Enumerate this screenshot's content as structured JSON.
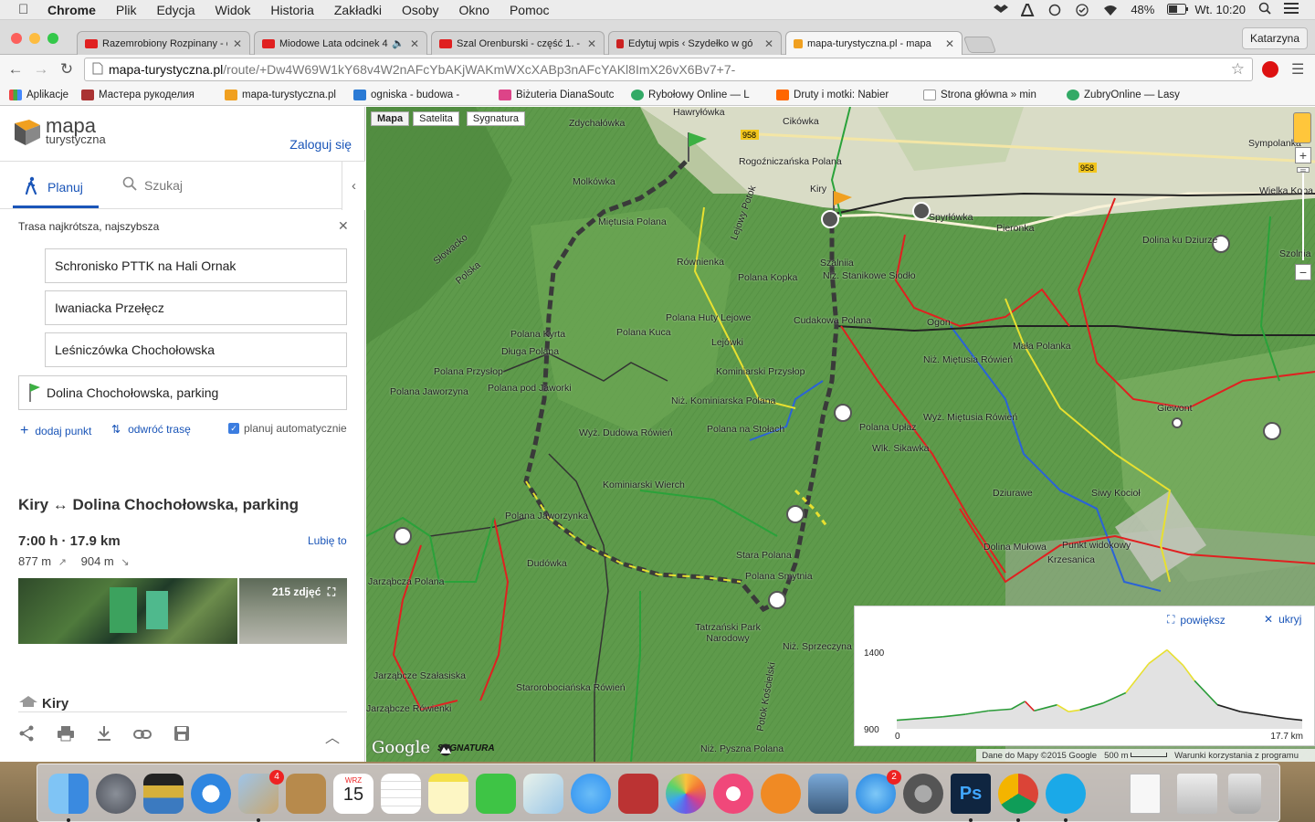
{
  "menubar": {
    "app": "Chrome",
    "items": [
      "Plik",
      "Edycja",
      "Widok",
      "Historia",
      "Zakładki",
      "Osoby",
      "Okno",
      "Pomoc"
    ],
    "battery": "48%",
    "clock": "Wt. 10:20"
  },
  "tabs": [
    {
      "title": "Razemrobiony Rozpinany - o",
      "favicon_color": "#e02020"
    },
    {
      "title": "Miodowe Lata odcinek 4",
      "favicon_color": "#e02020"
    },
    {
      "title": "Szal Orenburski - część 1. -",
      "favicon_color": "#e02020"
    },
    {
      "title": "Edytuj wpis ‹ Szydełko w gó",
      "favicon_color": "#c22"
    },
    {
      "title": "mapa-turystyczna.pl - mapa",
      "favicon_color": "#f0a020"
    }
  ],
  "profile": "Katarzyna",
  "url": {
    "domain": "mapa-turystyczna.pl",
    "path": "/route/+Dw4W69W1kY68v4W2nAFcYbAKjWAKmWXcXABp3nAFcYAKl8ImX26vX6Bv7+7-"
  },
  "bookmarks": [
    {
      "label": "Aplikacje",
      "color": "#e44"
    },
    {
      "label": "Мастера рукоделия",
      "color": "#a33"
    },
    {
      "label": "mapa-turystyczna.pl",
      "color": "#f0a020"
    },
    {
      "label": "ogniska - budowa -",
      "color": "#2a7ad5"
    },
    {
      "label": "Biżuteria DianaSoutc",
      "color": "#d48"
    },
    {
      "label": "Rybołowy Online — L",
      "color": "#3a6"
    },
    {
      "label": "Druty i motki: Nabier",
      "color": "#f60"
    },
    {
      "label": "Strona główna » min",
      "color": "#aaa"
    },
    {
      "label": "ŻubryOnline — Lasy",
      "color": "#3a6"
    }
  ],
  "sidebar": {
    "logo_line1": "mapa",
    "logo_line2": "turystyczna",
    "login": "Zaloguj się",
    "tab_plan": "Planuj",
    "tab_search": "Szukaj",
    "route_type": "Trasa najkrótsza, najszybsza",
    "waypoints": [
      "Schronisko PTTK na Hali Ornak",
      "Iwaniacka Przełęcz",
      "Leśniczówka Chochołowska"
    ],
    "destination": "Dolina Chochołowska, parking",
    "add_point": "dodaj punkt",
    "reverse": "odwróć trasę",
    "auto_plan": "planuj automatycznie",
    "route_title": "Kiry ↔ Dolina Chochołowska, parking",
    "stats": "7:00 h · 17.9 km",
    "like": "Lubię to",
    "ascent": "877 m",
    "descent": "904 m",
    "photos": "215 zdjęć",
    "section": "Kiry"
  },
  "map": {
    "type_buttons": [
      "Mapa",
      "Satelita",
      "Sygnatura"
    ],
    "labels": [
      "Hawryłówka",
      "Zdychałówka",
      "Molkówka",
      "Miętusia Polana",
      "Równienka",
      "Lejowy Potok",
      "Cikówka",
      "Rogoźniczańska Polana",
      "Kiry",
      "Spyrłówka",
      "Pieronka",
      "Dolina ku Dziurze",
      "Polana Kopka",
      "Polana Huty Lejowe",
      "Lejówki",
      "Polana Kuca",
      "Kominiarski Przysłop",
      "Niż. Kominiarska Polana",
      "Polana na Stołach",
      "Wyż. Dudowa Rówień",
      "Kominiarski Wierch",
      "Polana Kyrta",
      "Długa Polana",
      "Polana Przysłop",
      "Polana pod Jaworki",
      "Polana Jaworzyna",
      "Słowacko",
      "Polska",
      "Szalniia",
      "Niż. Stanikowe Siodło",
      "Cudakowa Polana",
      "Ogon",
      "Niż. Miętusia Rówień",
      "Mała Polanka",
      "Wyż. Miętusia Rówień",
      "Polana Upłaz",
      "Wlk. Sikawka",
      "Giewont",
      "Dziurawe",
      "Siwy Kocioł",
      "Dolina Mułowa",
      "Punkt widokowy",
      "Krzesanica",
      "Polana Jaworzynka",
      "Dudówka",
      "Jarząbcza Polana",
      "Jarząbcze Szałasiska",
      "Jarząbcze Rówienki",
      "Starorobociańska Rówień",
      "Stara Polana",
      "Polana Smytnia",
      "Tatrzański Park Narodowy",
      "Niż. Sprzeczyna",
      "Potok Kościelski",
      "Niż. Pyszna Polana",
      "Sympolanka",
      "Wielka Kopa",
      "Szolnia"
    ],
    "road_labels": [
      "958",
      "958"
    ],
    "attribution_data": "Dane do Mapy ©2015 Google",
    "attribution_scale": "500 m",
    "attribution_terms": "Warunki korzystania z programu",
    "google": "Google",
    "sygnatura": "SYGNATURA"
  },
  "elevation": {
    "enlarge": "powiększ",
    "hide": "ukryj",
    "y_max_label": "1400",
    "y_min_label": "900",
    "x_start_label": "0",
    "x_end_label": "17.7 km"
  },
  "chart_data": {
    "type": "area",
    "title": "",
    "xlabel": "",
    "ylabel": "",
    "xlim": [
      0,
      17.7
    ],
    "ylim": [
      900,
      1400
    ],
    "x": [
      0,
      1,
      2,
      3,
      4,
      5,
      5.6,
      6,
      7,
      7.5,
      8,
      9,
      10,
      11,
      11.8,
      12.5,
      13,
      14,
      15,
      16,
      17,
      17.7
    ],
    "y": [
      950,
      960,
      970,
      985,
      1005,
      1015,
      1060,
      1005,
      1040,
      1000,
      1010,
      1050,
      1110,
      1280,
      1360,
      1270,
      1180,
      1040,
      1000,
      980,
      960,
      950
    ]
  },
  "dock": {
    "calendar_month": "WRZ",
    "calendar_day": "15",
    "mail_badge": "4",
    "appstore_badge": "2"
  }
}
